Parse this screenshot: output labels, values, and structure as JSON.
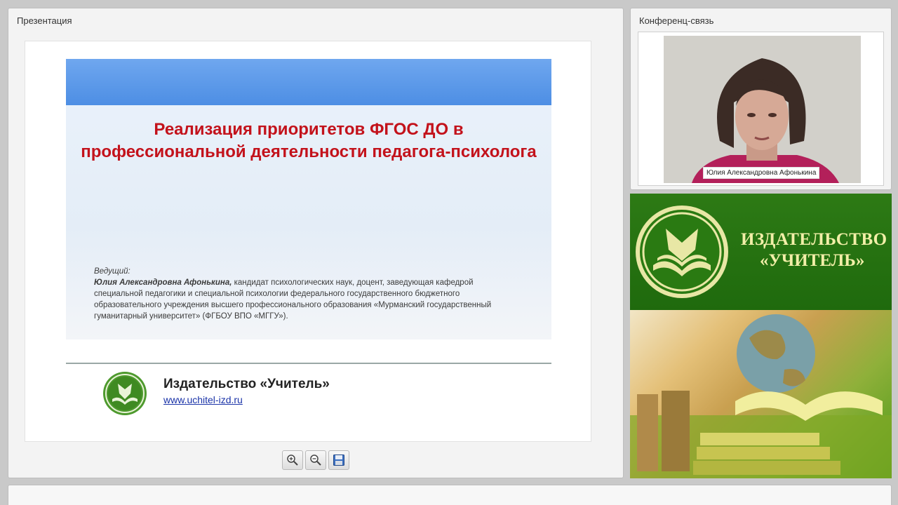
{
  "presentation_panel": {
    "title": "Презентация",
    "slide": {
      "title": "Реализация приоритетов ФГОС ДО в профессиональной деятельности педагога-психолога",
      "presenter_label": "Ведущий:",
      "presenter_name": "Юлия Александровна Афонькина,",
      "presenter_details": "кандидат психологических наук, доцент, заведующая кафедрой специальной педагогики и специальной психологии федерального государственного бюджетного образовательного учреждения высшего профессионального образования «Мурманский государственный гуманитарный университет» (ФГБОУ ВПО «МГГУ»).",
      "publisher": "Издательство «Учитель»",
      "url": "www.uchitel-izd.ru"
    },
    "toolbar": {
      "zoom_in_icon": "zoom-in-icon",
      "zoom_out_icon": "zoom-out-icon",
      "save_icon": "save-icon"
    }
  },
  "conference_panel": {
    "title": "Конференц-связь",
    "video_caption": "Юлия Александровна Афонькина"
  },
  "banner": {
    "name_line1": "ИЗДАТЕЛЬСТВО",
    "name_line2": "«УЧИТЕЛЬ»"
  },
  "colors": {
    "slide_title": "#c3121b",
    "banner_green": "#2d7a15",
    "banner_text": "#f2efa8",
    "link": "#1a33a8"
  }
}
